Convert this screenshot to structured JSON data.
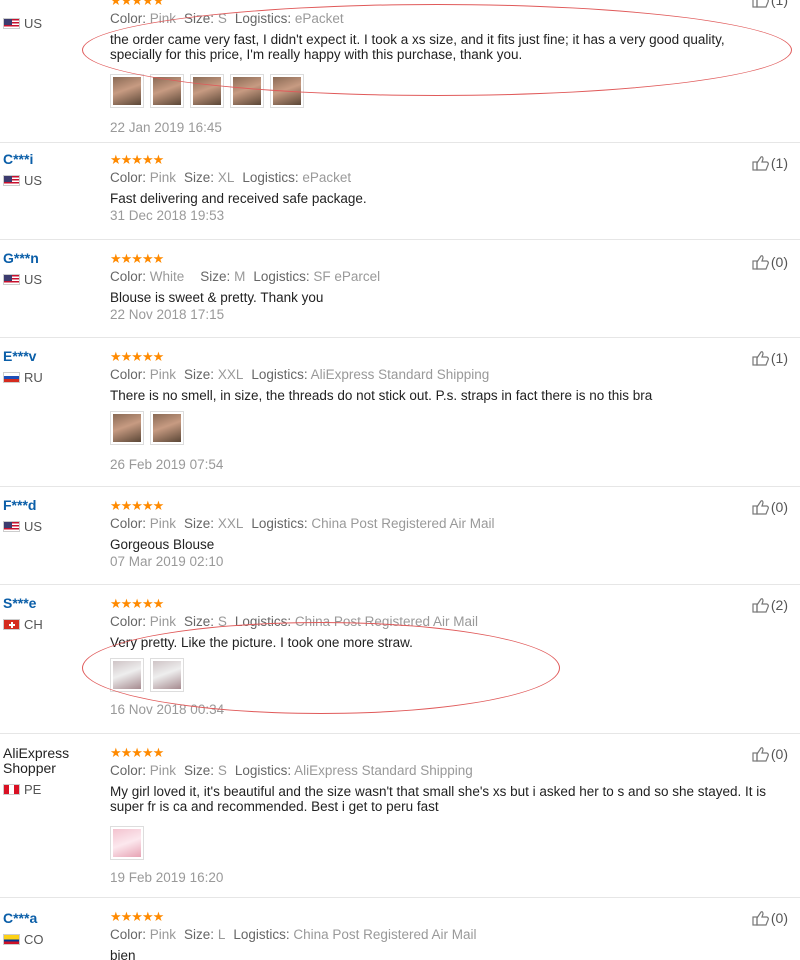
{
  "labels": {
    "color": "Color:",
    "size": "Size:",
    "logistics": "Logistics:"
  },
  "reviews": [
    {
      "name": "",
      "country": "US",
      "stars": "★★★★★",
      "color": "Pink",
      "size": "S",
      "logistics": "ePacket",
      "text": "the order came very fast, I didn't expect it. I took a xs size, and it fits just fine; it has a very good quality, specially for this price, I'm really happy with this purchase, thank you.",
      "date": "22 Jan 2019 16:45",
      "likes": "(1)"
    },
    {
      "name": "C***i",
      "country": "US",
      "stars": "★★★★★",
      "color": "Pink",
      "size": "XL",
      "logistics": "ePacket",
      "text": "Fast delivering and received safe package.",
      "date": "31 Dec 2018 19:53",
      "likes": "(1)"
    },
    {
      "name": "G***n",
      "country": "US",
      "stars": "★★★★★",
      "color": "White",
      "size": "M",
      "logistics": "SF eParcel",
      "text": "Blouse is sweet & pretty. Thank you",
      "date": "22 Nov 2018 17:15",
      "likes": "(0)"
    },
    {
      "name": "E***v",
      "country": "RU",
      "stars": "★★★★★",
      "color": "Pink",
      "size": "XXL",
      "logistics": "AliExpress Standard Shipping",
      "text": "There is no smell, in size, the threads do not stick out. P.s. straps in fact there is no this bra",
      "date": "26 Feb 2019 07:54",
      "likes": "(1)"
    },
    {
      "name": "F***d",
      "country": "US",
      "stars": "★★★★★",
      "color": "Pink",
      "size": "XXL",
      "logistics": "China Post Registered Air Mail",
      "text": "Gorgeous Blouse",
      "date": "07 Mar 2019 02:10",
      "likes": "(0)"
    },
    {
      "name": "S***e",
      "country": "CH",
      "stars": "★★★★★",
      "color": "Pink",
      "size": "S",
      "logistics": "China Post Registered Air Mail",
      "text": "Very pretty. Like the picture. I took one more straw.",
      "date": "16 Nov 2018 00:34",
      "likes": "(2)"
    },
    {
      "name": "AliExpress Shopper",
      "country": "PE",
      "stars": "★★★★★",
      "color": "Pink",
      "size": "S",
      "logistics": "AliExpress Standard Shipping",
      "text": "My girl loved it, it's beautiful and the size wasn't that small she's xs but i asked her to s and so she stayed. It is super fr is ca and recommended. Best i get to peru fast",
      "date": "19 Feb 2019 16:20",
      "likes": "(0)"
    },
    {
      "name": "C***a",
      "country": "CO",
      "stars": "★★★★★",
      "color": "Pink",
      "size": "L",
      "logistics": "China Post Registered Air Mail",
      "text": "bien",
      "date": "",
      "likes": "(0)"
    }
  ]
}
